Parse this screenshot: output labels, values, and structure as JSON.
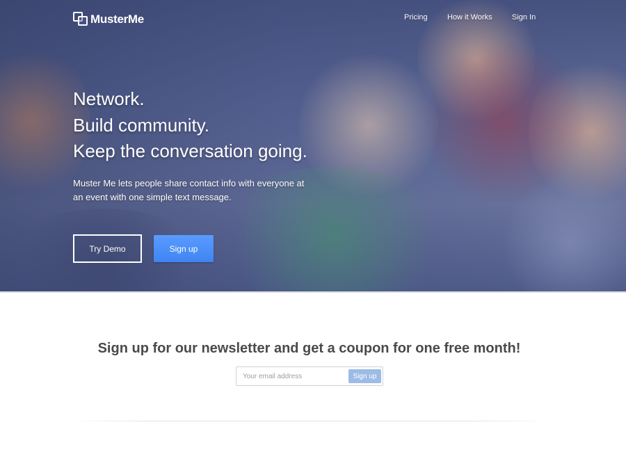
{
  "brand": {
    "name": "MusterMe"
  },
  "nav": {
    "items": [
      {
        "label": "Pricing"
      },
      {
        "label": "How it Works"
      },
      {
        "label": "Sign In"
      }
    ]
  },
  "hero": {
    "headline_lines": [
      "Network.",
      "Build community.",
      "Keep the conversation going."
    ],
    "description": "Muster Me lets people share contact info with everyone at an event with one simple text message.",
    "try_demo_label": "Try Demo",
    "signup_label": "Sign up"
  },
  "newsletter": {
    "title": "Sign up for our newsletter and get a coupon for one free month!",
    "email_placeholder": "Your email address",
    "email_value": "",
    "submit_label": "Sign up"
  },
  "colors": {
    "primary_button": "#4a8ff8",
    "newsletter_button": "#9cbbe6",
    "hero_overlay": "#3e4a7a"
  },
  "icons": {
    "logo": "muster-me-logo-icon"
  }
}
